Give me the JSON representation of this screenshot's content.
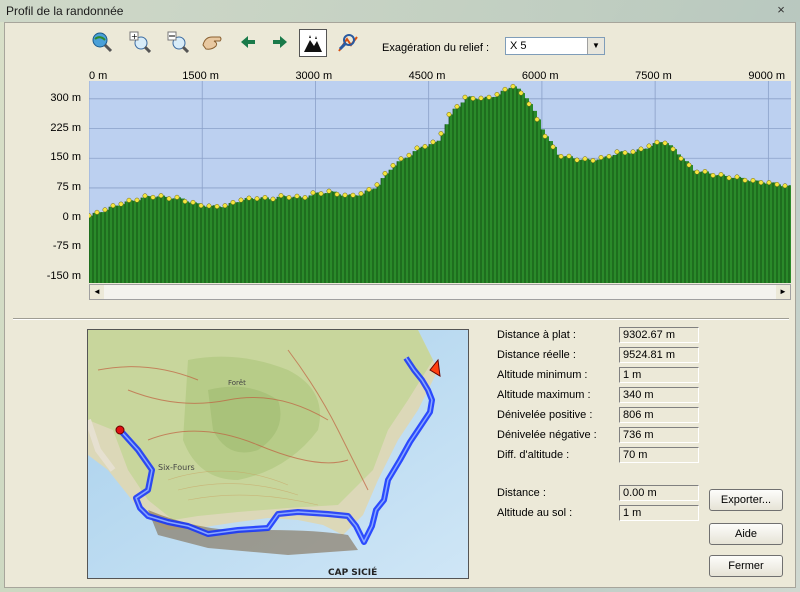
{
  "window": {
    "title": "Profil de la randonnée",
    "close_glyph": "×"
  },
  "toolbar": {
    "icons": [
      "zoom-globe-icon",
      "zoom-in-icon",
      "zoom-out-icon",
      "hand-pan-icon",
      "arrow-left-icon",
      "arrow-right-icon",
      "terrain-view-icon",
      "zoom-search-icon"
    ],
    "exag_label": "Exagération du relief :",
    "exag_value": "X 5"
  },
  "chart_data": {
    "type": "area",
    "title": "",
    "xlabel": "",
    "ylabel": "",
    "x_ticks": [
      "0 m",
      "1500 m",
      "3000 m",
      "4500 m",
      "6000 m",
      "7500 m",
      "9000 m"
    ],
    "y_ticks": [
      "300 m",
      "225 m",
      "150 m",
      "75 m",
      "0 m",
      "-75 m",
      "-150 m"
    ],
    "xlim": [
      0,
      9300
    ],
    "ylim": [
      -165,
      345
    ],
    "fill_color": "#2a8a2a",
    "background": "#bcd0f0",
    "grid": true,
    "x": [
      0,
      200,
      400,
      600,
      800,
      1000,
      1200,
      1400,
      1600,
      1800,
      2000,
      2200,
      2400,
      2600,
      2800,
      3000,
      3200,
      3400,
      3600,
      3800,
      4000,
      4200,
      4400,
      4600,
      4800,
      5000,
      5200,
      5400,
      5600,
      5800,
      6000,
      6200,
      6400,
      6600,
      6800,
      7000,
      7200,
      7400,
      7600,
      7800,
      8000,
      8200,
      8400,
      8600,
      8800,
      9000,
      9300
    ],
    "values": [
      5,
      20,
      35,
      45,
      55,
      52,
      48,
      35,
      28,
      30,
      45,
      50,
      48,
      55,
      50,
      62,
      65,
      55,
      60,
      80,
      130,
      155,
      180,
      190,
      270,
      305,
      300,
      310,
      335,
      300,
      220,
      160,
      150,
      145,
      150,
      165,
      165,
      180,
      195,
      160,
      120,
      112,
      105,
      100,
      92,
      88,
      78
    ]
  },
  "scrollbar": {
    "left_arrow": "◄",
    "right_arrow": "►"
  },
  "map": {
    "place_label": "CAP SICIÉ"
  },
  "stats": [
    {
      "label": "Distance à plat :",
      "value": "9302.67 m"
    },
    {
      "label": "Distance réelle :",
      "value": "9524.81 m"
    },
    {
      "label": "Altitude minimum :",
      "value": "1 m"
    },
    {
      "label": "Altitude maximum :",
      "value": "340 m"
    },
    {
      "label": "Dénivelée positive :",
      "value": "806 m"
    },
    {
      "label": "Dénivelée négative :",
      "value": "736 m"
    },
    {
      "label": "Diff. d'altitude :",
      "value": "70 m"
    }
  ],
  "cursor": [
    {
      "label": "Distance :",
      "value": "0.00 m"
    },
    {
      "label": "Altitude au sol :",
      "value": "1 m"
    }
  ],
  "buttons": {
    "export": "Exporter...",
    "help": "Aide",
    "close": "Fermer"
  }
}
